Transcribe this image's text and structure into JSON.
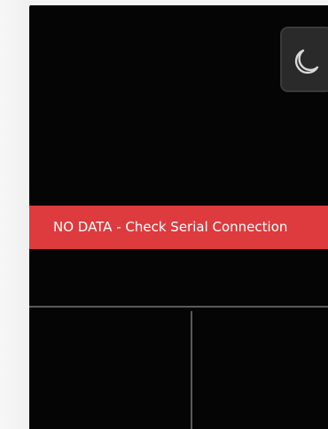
{
  "status_banner": {
    "message": "NO DATA - Check Serial Connection",
    "color": "#dd3b3e"
  },
  "theme_toggle": {
    "icon": "moon-icon"
  },
  "colors": {
    "screen_background": "#050505",
    "divider": "#5a5a5a"
  }
}
